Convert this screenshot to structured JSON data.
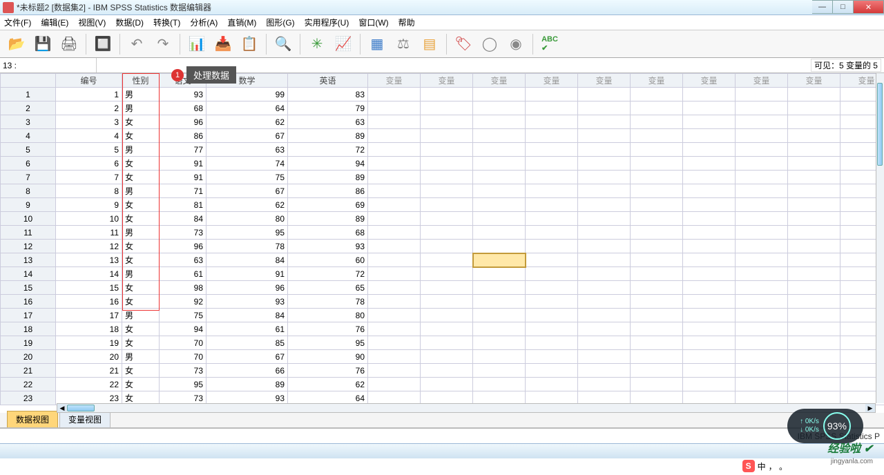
{
  "window": {
    "title": "*未标题2 [数据集2] - IBM SPSS Statistics 数据编辑器"
  },
  "menu": [
    "文件(F)",
    "编辑(E)",
    "视图(V)",
    "数据(D)",
    "转换(T)",
    "分析(A)",
    "直销(M)",
    "图形(G)",
    "实用程序(U)",
    "窗口(W)",
    "帮助"
  ],
  "cellref": "13 :",
  "visible": "可见：5 变量的 5",
  "callout": {
    "num": "1",
    "text": "处理数据"
  },
  "columns": [
    "编号",
    "性别",
    "语文",
    "数学",
    "英语",
    "变量",
    "变量",
    "变量",
    "变量",
    "变量",
    "变量",
    "变量",
    "变量",
    "变量",
    "变量"
  ],
  "rows": [
    {
      "n": 1,
      "c": [
        1,
        "男",
        93,
        99,
        83
      ]
    },
    {
      "n": 2,
      "c": [
        2,
        "男",
        68,
        64,
        79
      ]
    },
    {
      "n": 3,
      "c": [
        3,
        "女",
        96,
        62,
        63
      ]
    },
    {
      "n": 4,
      "c": [
        4,
        "女",
        86,
        67,
        89
      ]
    },
    {
      "n": 5,
      "c": [
        5,
        "男",
        77,
        63,
        72
      ]
    },
    {
      "n": 6,
      "c": [
        6,
        "女",
        91,
        74,
        94
      ]
    },
    {
      "n": 7,
      "c": [
        7,
        "女",
        91,
        75,
        89
      ]
    },
    {
      "n": 8,
      "c": [
        8,
        "男",
        71,
        67,
        86
      ]
    },
    {
      "n": 9,
      "c": [
        9,
        "女",
        81,
        62,
        69
      ]
    },
    {
      "n": 10,
      "c": [
        10,
        "女",
        84,
        80,
        89
      ]
    },
    {
      "n": 11,
      "c": [
        11,
        "男",
        73,
        95,
        68
      ]
    },
    {
      "n": 12,
      "c": [
        12,
        "女",
        96,
        78,
        93
      ]
    },
    {
      "n": 13,
      "c": [
        13,
        "女",
        63,
        84,
        60
      ]
    },
    {
      "n": 14,
      "c": [
        14,
        "男",
        61,
        91,
        72
      ]
    },
    {
      "n": 15,
      "c": [
        15,
        "女",
        98,
        96,
        65
      ]
    },
    {
      "n": 16,
      "c": [
        16,
        "女",
        92,
        93,
        78
      ]
    },
    {
      "n": 17,
      "c": [
        17,
        "男",
        75,
        84,
        80
      ]
    },
    {
      "n": 18,
      "c": [
        18,
        "女",
        94,
        61,
        76
      ]
    },
    {
      "n": 19,
      "c": [
        19,
        "女",
        70,
        85,
        95
      ]
    },
    {
      "n": 20,
      "c": [
        20,
        "男",
        70,
        67,
        90
      ]
    },
    {
      "n": 21,
      "c": [
        21,
        "女",
        73,
        66,
        76
      ]
    },
    {
      "n": 22,
      "c": [
        22,
        "女",
        95,
        89,
        62
      ]
    },
    {
      "n": 23,
      "c": [
        23,
        "女",
        73,
        93,
        64
      ]
    }
  ],
  "selected": {
    "row": 13,
    "col": 8
  },
  "tabs": {
    "data": "数据视图",
    "var": "变量视图"
  },
  "status": "IBM SPSS Statistics P",
  "ime": {
    "label": "中"
  },
  "net": {
    "up": "0K/s",
    "down": "0K/s",
    "pct": "93%"
  },
  "watermark": {
    "main": "经验啦 ✔",
    "sub": "jingyanla.com"
  },
  "toolbar_icons": [
    "open-file-icon",
    "save-icon",
    "print-icon",
    "recall-dialog-icon",
    "undo-icon",
    "redo-icon",
    "goto-case-icon",
    "goto-variable-icon",
    "variables-icon",
    "find-icon",
    "insert-case-icon",
    "insert-variable-icon",
    "split-file-icon",
    "weight-cases-icon",
    "select-cases-icon",
    "value-labels-icon",
    "use-sets-icon",
    "show-all-icon",
    "spellcheck-icon"
  ]
}
